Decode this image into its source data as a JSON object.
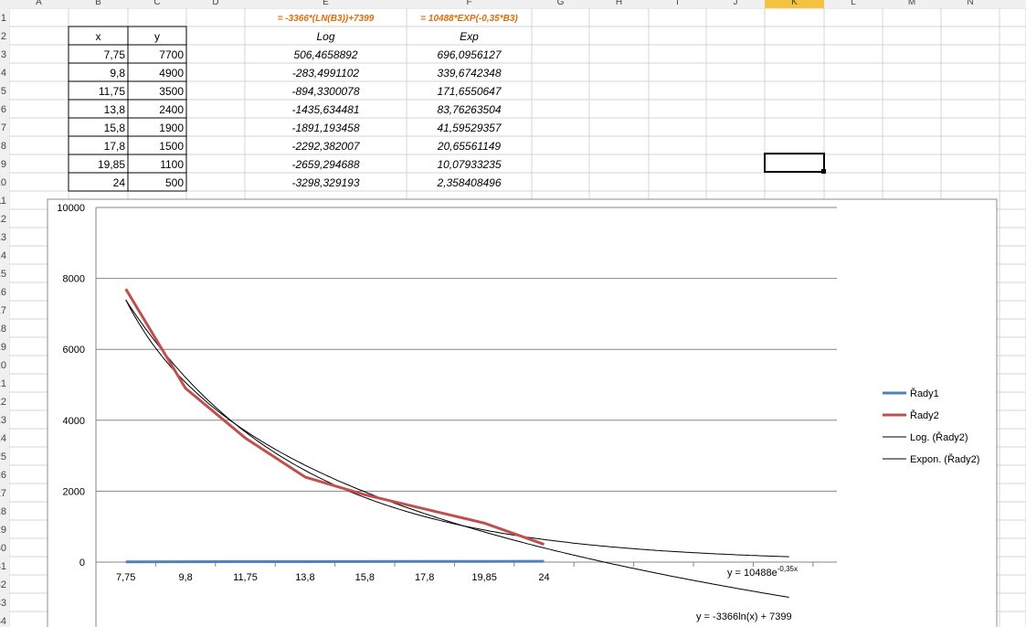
{
  "sheet": {
    "columns": [
      "A",
      "B",
      "C",
      "D",
      "E",
      "F",
      "G",
      "H",
      "I",
      "J",
      "K",
      "L",
      "M",
      "N"
    ],
    "rows": [
      "1",
      "2",
      "3",
      "4",
      "5",
      "6",
      "7",
      "8",
      "9",
      "10",
      "11",
      "12",
      "13",
      "14",
      "15",
      "16",
      "17",
      "18",
      "19",
      "20",
      "21",
      "22",
      "23",
      "24",
      "25",
      "26",
      "27",
      "28",
      "29",
      "30",
      "31",
      "32",
      "33",
      "34"
    ],
    "selected_column": "K",
    "formula_e": "= -3366*(LN(B3))+7399",
    "formula_f": "= 10488*EXP(-0,35*B3)",
    "header_x": "x",
    "header_y": "y",
    "header_log": "Log",
    "header_exp": "Exp",
    "table": [
      {
        "x": "7,75",
        "y": "7700",
        "log": "506,4658892",
        "exp": "696,0956127"
      },
      {
        "x": "9,8",
        "y": "4900",
        "log": "-283,4991102",
        "exp": "339,6742348"
      },
      {
        "x": "11,75",
        "y": "3500",
        "log": "-894,3300078",
        "exp": "171,6550647"
      },
      {
        "x": "13,8",
        "y": "2400",
        "log": "-1435,634481",
        "exp": "83,76263504"
      },
      {
        "x": "15,8",
        "y": "1900",
        "log": "-1891,193458",
        "exp": "41,59529357"
      },
      {
        "x": "17,8",
        "y": "1500",
        "log": "-2292,382007",
        "exp": "20,65561149"
      },
      {
        "x": "19,85",
        "y": "1100",
        "log": "-2659,294688",
        "exp": "10,07933235"
      },
      {
        "x": "24",
        "y": "500",
        "log": "-3298,329193",
        "exp": "2,358408496"
      }
    ],
    "colors": {
      "formula": "#e36c09",
      "grid": "#d4d4d4",
      "header_bg": "#f0f0f0",
      "selected_header": "#f5c342"
    }
  },
  "chart_data": {
    "type": "line",
    "categories": [
      "7,75",
      "9,8",
      "11,75",
      "13,8",
      "15,8",
      "17,8",
      "19,85",
      "24"
    ],
    "x_values": [
      7.75,
      9.8,
      11.75,
      13.8,
      15.8,
      17.8,
      19.85,
      24
    ],
    "series": [
      {
        "name": "Řady1",
        "color": "#4f81bd",
        "values": [
          7.75,
          9.8,
          11.75,
          13.8,
          15.8,
          17.8,
          19.85,
          24
        ]
      },
      {
        "name": "Řady2",
        "color": "#c0504d",
        "values": [
          7700,
          4900,
          3500,
          2400,
          1900,
          1500,
          1100,
          500
        ]
      }
    ],
    "trendlines": [
      {
        "name": "Log. (Řady2)",
        "kind": "log",
        "a": -3366,
        "b": 7399,
        "equation": "y = -3366ln(x) + 7399"
      },
      {
        "name": "Expon. (Řady2)",
        "kind": "exp",
        "a": 10488,
        "b": -0.35,
        "equation": "y = 10488e",
        "equation_sup": "-0,35x"
      }
    ],
    "yticks": [
      "10000",
      "8000",
      "6000",
      "4000",
      "2000",
      "0"
    ],
    "ylim": [
      0,
      10000
    ],
    "grid": true,
    "legend": "right"
  }
}
